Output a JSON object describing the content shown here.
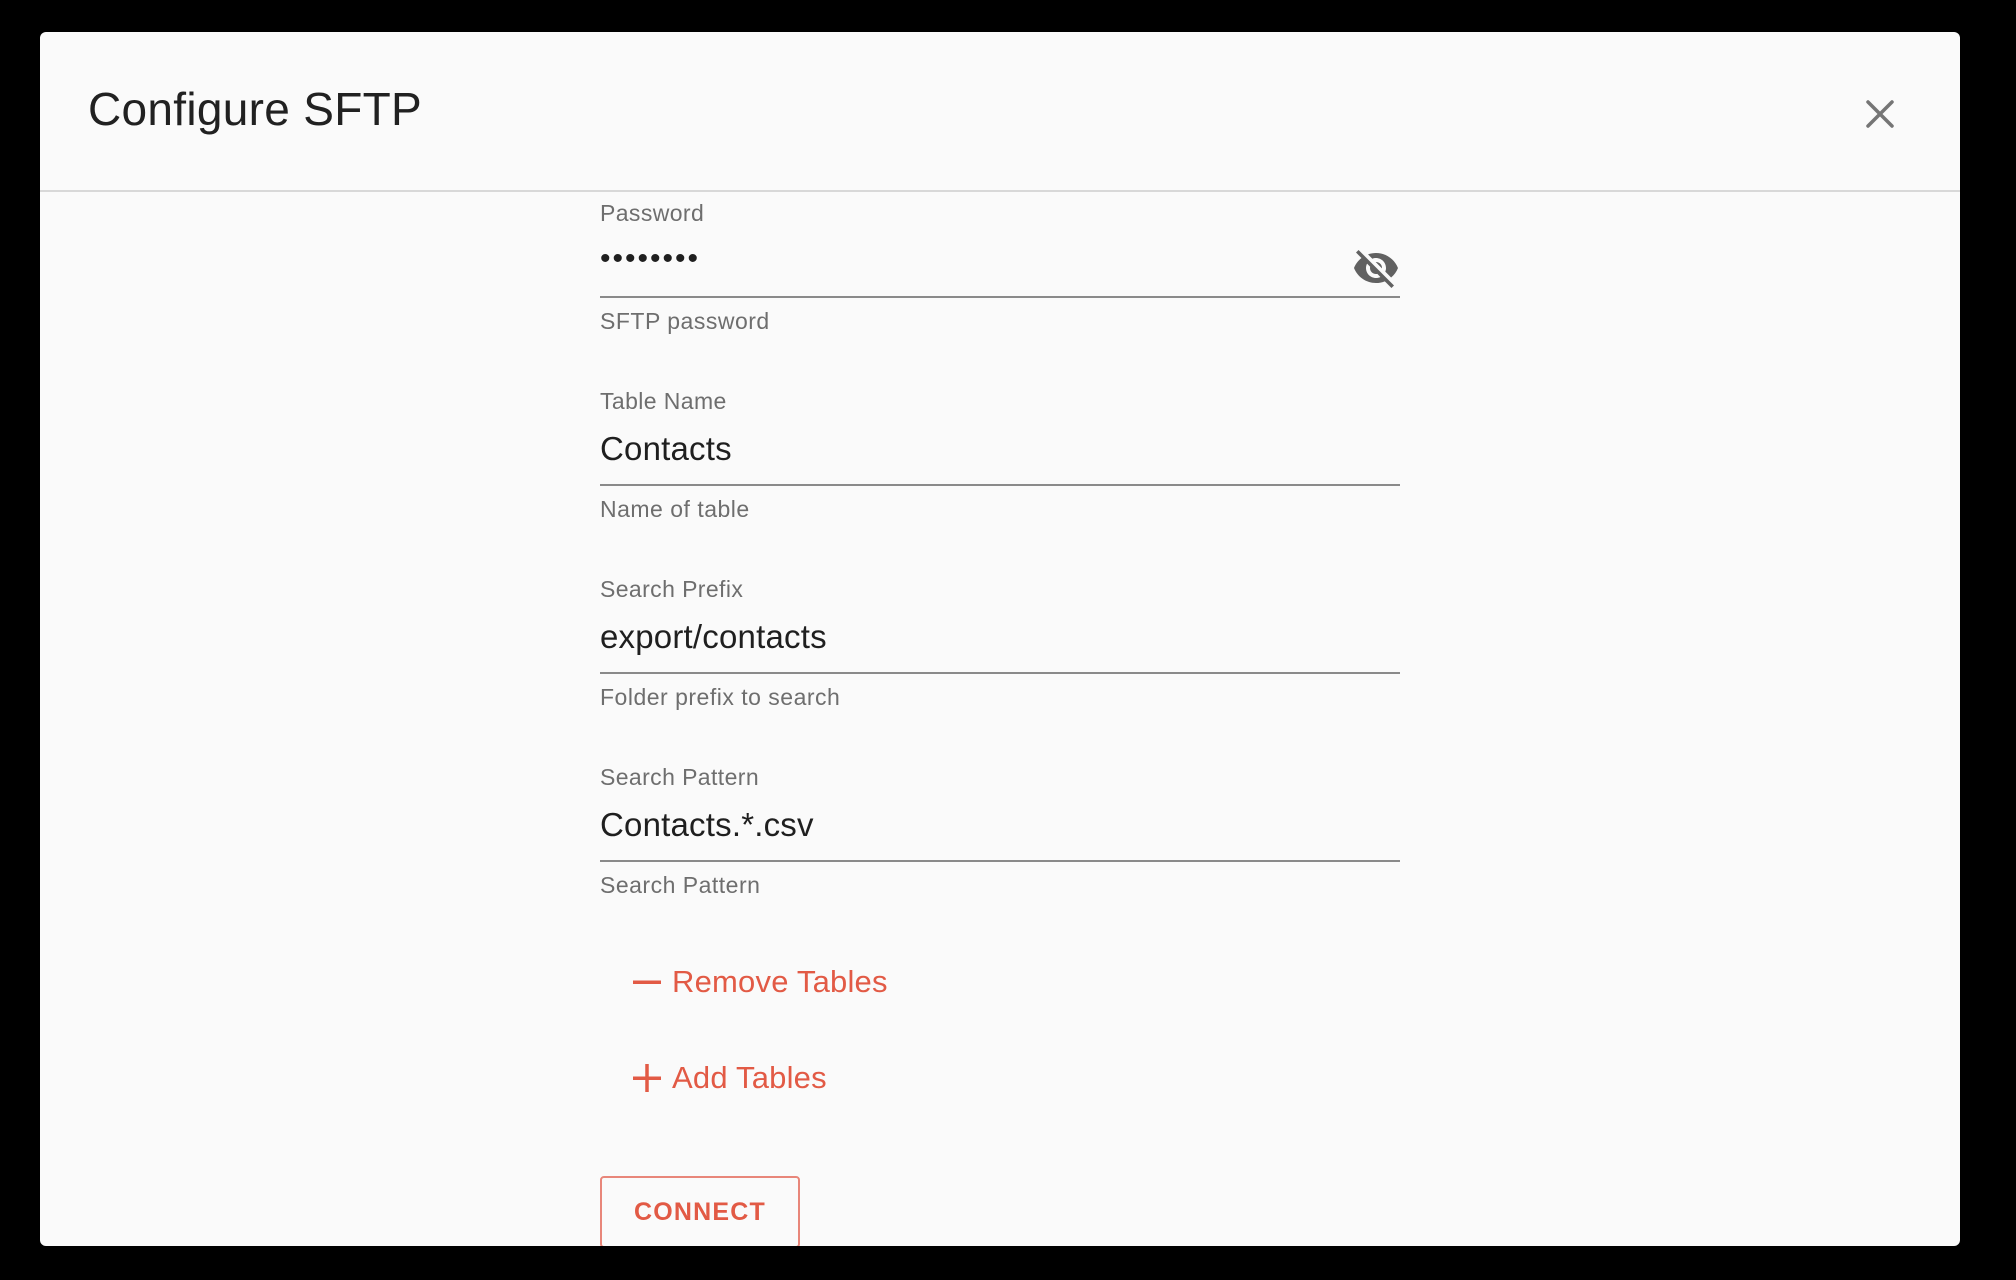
{
  "dialog": {
    "title": "Configure SFTP",
    "close_icon": "close-icon"
  },
  "fields": {
    "password": {
      "label": "Password",
      "value": "••••••••",
      "helper": "SFTP password",
      "toggle_icon": "eye-off-icon"
    },
    "table_name": {
      "label": "Table Name",
      "value": "Contacts",
      "helper": "Name of table"
    },
    "search_prefix": {
      "label": "Search Prefix",
      "value": "export/contacts",
      "helper": "Folder prefix to search"
    },
    "search_pattern": {
      "label": "Search Pattern",
      "value": "Contacts.*.csv",
      "helper": "Search Pattern"
    }
  },
  "actions": {
    "remove_tables": "Remove Tables",
    "add_tables": "Add Tables",
    "connect": "CONNECT"
  },
  "colors": {
    "accent": "#e25a45",
    "background": "#fafafa",
    "backdrop": "#000000"
  }
}
